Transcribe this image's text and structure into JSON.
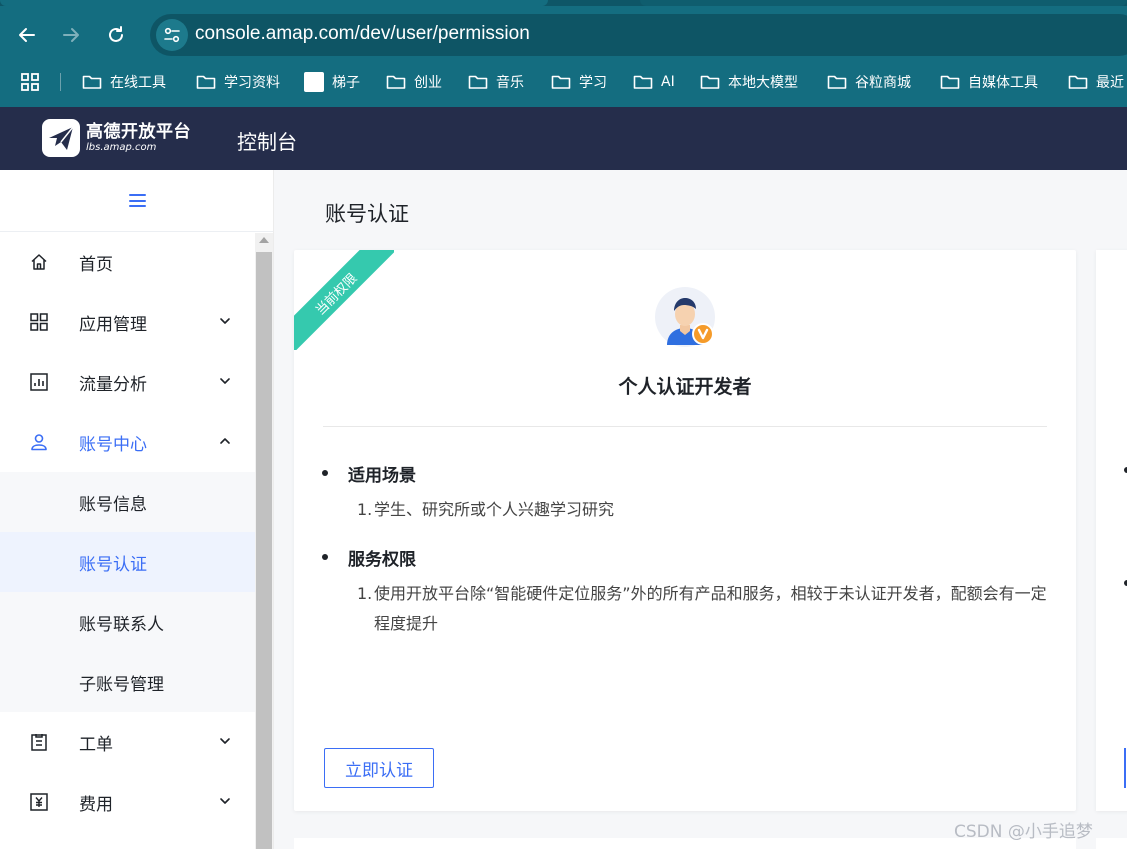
{
  "browser": {
    "url": "console.amap.com/dev/user/permission",
    "bookmarks": [
      {
        "label": "在线工具",
        "icon": "folder-icon"
      },
      {
        "label": "学习资料",
        "icon": "folder-icon"
      },
      {
        "label": "梯子",
        "icon": "white-square-icon"
      },
      {
        "label": "创业",
        "icon": "folder-icon"
      },
      {
        "label": "音乐",
        "icon": "folder-icon"
      },
      {
        "label": "学习",
        "icon": "folder-icon"
      },
      {
        "label": "AI",
        "icon": "folder-icon"
      },
      {
        "label": "本地大模型",
        "icon": "folder-icon"
      },
      {
        "label": "谷粒商城",
        "icon": "folder-icon"
      },
      {
        "label": "自媒体工具",
        "icon": "folder-icon"
      },
      {
        "label": "最近",
        "icon": "folder-icon"
      }
    ]
  },
  "header": {
    "logo_title": "高德开放平台",
    "logo_sub": "lbs.amap.com",
    "console_label": "控制台",
    "bg_color": "#252d4b"
  },
  "sidebar": {
    "items": [
      {
        "label": "首页",
        "icon": "home-icon"
      },
      {
        "label": "应用管理",
        "icon": "apps-grid-icon",
        "chevron": "down"
      },
      {
        "label": "流量分析",
        "icon": "bar-chart-icon",
        "chevron": "down"
      },
      {
        "label": "账号中心",
        "icon": "user-icon",
        "chevron": "up",
        "active": true
      },
      {
        "label": "工单",
        "icon": "clipboard-icon",
        "chevron": "down"
      },
      {
        "label": "费用",
        "icon": "yuan-icon",
        "chevron": "down"
      }
    ],
    "subitems": [
      {
        "label": "账号信息"
      },
      {
        "label": "账号认证",
        "selected": true
      },
      {
        "label": "账号联系人"
      },
      {
        "label": "子账号管理"
      }
    ],
    "accent_color": "#3b6ef5"
  },
  "main": {
    "page_title": "账号认证",
    "card": {
      "ribbon": "当前权限",
      "ribbon_color": "#35c9ae",
      "title": "个人认证开发者",
      "sections": [
        {
          "heading": "适用场景",
          "items": [
            {
              "num": "1.",
              "text": "学生、研究所或个人兴趣学习研究"
            }
          ]
        },
        {
          "heading": "服务权限",
          "items": [
            {
              "num": "1.",
              "text": "使用开放平台除“智能硬件定位服务”外的所有产品和服务，相较于未认证开发者，配额会有一定程度提升"
            }
          ]
        }
      ],
      "button": "立即认证"
    }
  },
  "watermark": "CSDN @小手追梦"
}
